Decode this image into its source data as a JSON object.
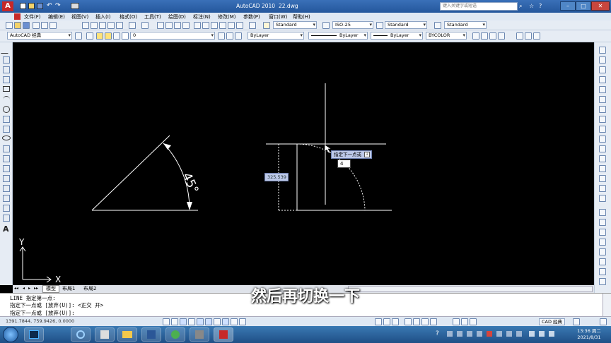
{
  "title": {
    "app": "AutoCAD 2010",
    "file": "22.dwg",
    "search_placeholder": "键入关键字或短语"
  },
  "menu": [
    "文件(F)",
    "编辑(E)",
    "视图(V)",
    "插入(I)",
    "格式(O)",
    "工具(T)",
    "绘图(D)",
    "标注(N)",
    "修改(M)",
    "参数(P)",
    "窗口(W)",
    "帮助(H)"
  ],
  "toolbar": {
    "text_style": "Standard",
    "dim_style": "ISO-25",
    "table_style": "Standard",
    "multileader_style": "Standard",
    "workspace": "AutoCAD 经典",
    "layer": "0",
    "color": "ByLayer",
    "linetype": "ByLayer",
    "lineweight": "ByLayer",
    "plotstyle": "BYCOLOR"
  },
  "drawing": {
    "angle_label": "45°",
    "tooltip_prompt": "指定下一点或",
    "dynamic_input_value": "4",
    "dim_readout": "325.539",
    "ucs_x": "X",
    "ucs_y": "Y"
  },
  "tabs": {
    "model": "模型",
    "layout1": "布局1",
    "layout2": "布局2"
  },
  "command": {
    "line1": "LINE 指定第一点:",
    "line2": "指定下一点或 [放弃(U)]:  <正交 开>",
    "line3": "指定下一点或 [放弃(U)]:"
  },
  "status": {
    "coords": "1391.7844, 759.9426, 0.0000",
    "workspace_btn": "CAD 经典"
  },
  "taskbar": {
    "time": "13:36 周二",
    "date": "2021/8/31"
  },
  "subtitle": "然后再切换一下",
  "colors": {
    "accent": "#24579c",
    "taskbar": "#2a5f96",
    "canvas": "#000000"
  }
}
